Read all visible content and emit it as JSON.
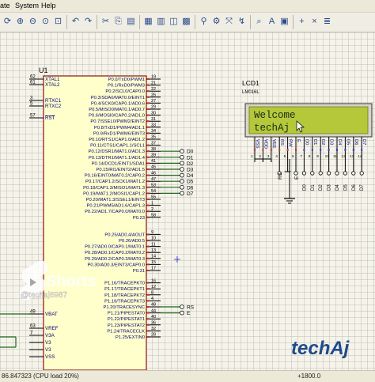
{
  "menu": {
    "items": [
      "ate",
      "System",
      "Help"
    ]
  },
  "toolbar": {
    "icons": [
      "refresh-icon",
      "zoom-in-icon",
      "zoom-out-icon",
      "zoom-fit-icon",
      "zoom-area-icon",
      "undo-icon",
      "redo-icon",
      "cut-icon",
      "copy-icon",
      "paste-icon",
      "block-copy-icon",
      "block-move-icon",
      "block-rotate-icon",
      "block-delete-icon",
      "pick-device-icon",
      "make-device-icon",
      "decompose-icon",
      "wire-autoroute-icon",
      "search-icon",
      "property-tool-icon",
      "design-explorer-icon",
      "new-sheet-icon",
      "remove-sheet-icon",
      "netlist-icon"
    ]
  },
  "mcu": {
    "ref": "U1",
    "left_pins": [
      {
        "num": "62",
        "name": "XTAL1"
      },
      {
        "num": "61",
        "name": "XTAL2"
      },
      {
        "num": "3",
        "name": "RTXC1"
      },
      {
        "num": "5",
        "name": "RTXC2"
      },
      {
        "num": "57",
        "name": "RST"
      },
      {
        "num": "49",
        "name": "VBAT"
      },
      {
        "num": "63",
        "name": "VREF"
      },
      {
        "num": "7",
        "name": "V3A"
      },
      {
        "num": "",
        "name": "V3"
      },
      {
        "num": "",
        "name": "V3"
      },
      {
        "num": "",
        "name": "VSS"
      }
    ],
    "right_pins": [
      {
        "name": "P0.0/TxD0/PWM1",
        "num": "19"
      },
      {
        "name": "P0.1/RxD0/PWM3",
        "num": "21"
      },
      {
        "name": "P0.2/SCL0/CAP0.0",
        "num": "22"
      },
      {
        "name": "P0.3/SDA0/MAT0.0/EINT1",
        "num": "26"
      },
      {
        "name": "P0.4/SCK0/CAP0.1/AD0.6",
        "num": "27"
      },
      {
        "name": "P0.5/MISO0/MAT0.1/AD0.7",
        "num": "29"
      },
      {
        "name": "P0.6/MOSI0/CAP0.2/AD1.0",
        "num": "30"
      },
      {
        "name": "P0.7/SSEL0/PWM2/EINT2",
        "num": "31"
      },
      {
        "name": "P0.8/TxD1/PWM4/AD1.1",
        "num": "33"
      },
      {
        "name": "P0.9/RxD1/PWM6/EINT3",
        "num": "34"
      },
      {
        "name": "P0.10/RTS1/CAP1.0/AD1.2",
        "num": "35"
      },
      {
        "name": "P0.11/CTS1/CAP1.1/SCL1",
        "num": "37"
      },
      {
        "name": "P0.12/DSR1/MAT1.0/AD1.3",
        "num": "38"
      },
      {
        "name": "P0.13/DTR1/MAT1.1/AD1.4",
        "num": "39"
      },
      {
        "name": "P0.14/DCD1/EINT1/SDA1",
        "num": "41"
      },
      {
        "name": "P0.15/RI1/EINT2/AD1.5",
        "num": "45"
      },
      {
        "name": "P0.16/EINT0/MAT0.2/CAP0.2",
        "num": "46"
      },
      {
        "name": "P0.17/CAP1.2/SCK1/MAT1.2",
        "num": "47"
      },
      {
        "name": "P0.18/CAP1.3/MISO1/MAT1.3",
        "num": "53"
      },
      {
        "name": "P0.19/MAT1.2/MOSI1/CAP1.2",
        "num": "54"
      },
      {
        "name": "P0.20/MAT1.3/SSEL1/EINT3",
        "num": "55"
      },
      {
        "name": "P0.21/PWM5/AD1.6/CAP1.3",
        "num": "1"
      },
      {
        "name": "P0.22/AD1.7/CAP0.0/MAT0.0",
        "num": "2"
      },
      {
        "name": "P0.23",
        "num": "58"
      },
      {
        "name": "P0.25/AD0.4/AOUT",
        "num": "9"
      },
      {
        "name": "P0.26/AD0.5",
        "num": "10"
      },
      {
        "name": "P0.27/AD0.0/CAP0.1/MAT0.1",
        "num": "11"
      },
      {
        "name": "P0.28/AD0.1/CAP0.2/MAT0.2",
        "num": "13"
      },
      {
        "name": "P0.29/AD0.2/CAP0.3/MAT0.3",
        "num": "14"
      },
      {
        "name": "P0.30/AD0.3/EINT3/CAP0.0",
        "num": "15"
      },
      {
        "name": "P0.31",
        "num": "17"
      },
      {
        "name": "P1.16/TRACEPKT0",
        "num": "16"
      },
      {
        "name": "P1.17/TRACEPKT1",
        "num": "12"
      },
      {
        "name": "P1.18/TRACEPKT2",
        "num": "8"
      },
      {
        "name": "P1.19/TRACEPKT3",
        "num": "4"
      },
      {
        "name": "P1.20/TRACESYNC",
        "num": "48"
      },
      {
        "name": "P1.21/PIPESTAT0",
        "num": "44"
      },
      {
        "name": "P1.22/PIPESTAT1",
        "num": "40"
      },
      {
        "name": "P1.23/PIPESTAT2",
        "num": "36"
      },
      {
        "name": "P1.24/TRACECLK",
        "num": "32"
      },
      {
        "name": "P1.25/EXTIN0",
        "num": "28"
      }
    ]
  },
  "nets": {
    "data_labels": [
      "D0",
      "D1",
      "D2",
      "D3",
      "D4",
      "D5",
      "D6",
      "D7"
    ],
    "control_labels": [
      "RS",
      "E"
    ]
  },
  "lcd": {
    "ref": "LCD1",
    "model": "LM016L",
    "line1": "Welcome",
    "line2": "techAj",
    "pins": [
      "VSS",
      "VDD",
      "VEE",
      "RS",
      "RW",
      "E",
      "D0",
      "D1",
      "D2",
      "D3",
      "D4",
      "D5",
      "D6",
      "D7"
    ],
    "pin_numbers": [
      "1",
      "2",
      "3",
      "4",
      "5",
      "6",
      "7",
      "8",
      "9",
      "10",
      "11",
      "12",
      "13",
      "14"
    ],
    "bus_labels": [
      "D0",
      "D1",
      "D2",
      "D3",
      "D4",
      "D5",
      "D6",
      "D7"
    ],
    "left_labels": [
      "RS",
      "E"
    ]
  },
  "watermarks": {
    "shorts_text": "Shorts",
    "channel_handle": "@techaj6987",
    "brand": "techAj"
  },
  "status": {
    "left": "86.847323 (CPU load 20%)",
    "right": "+1800.0"
  },
  "colors": {
    "component_body": "#ffffcc",
    "component_outline": "#8a1212",
    "wire": "#1a6a1a",
    "pin_label": "#000080",
    "lcd_screen": "#b4c83a",
    "lcd_text": "#1b2a1b",
    "brand_blue": "#1e4b8c"
  }
}
